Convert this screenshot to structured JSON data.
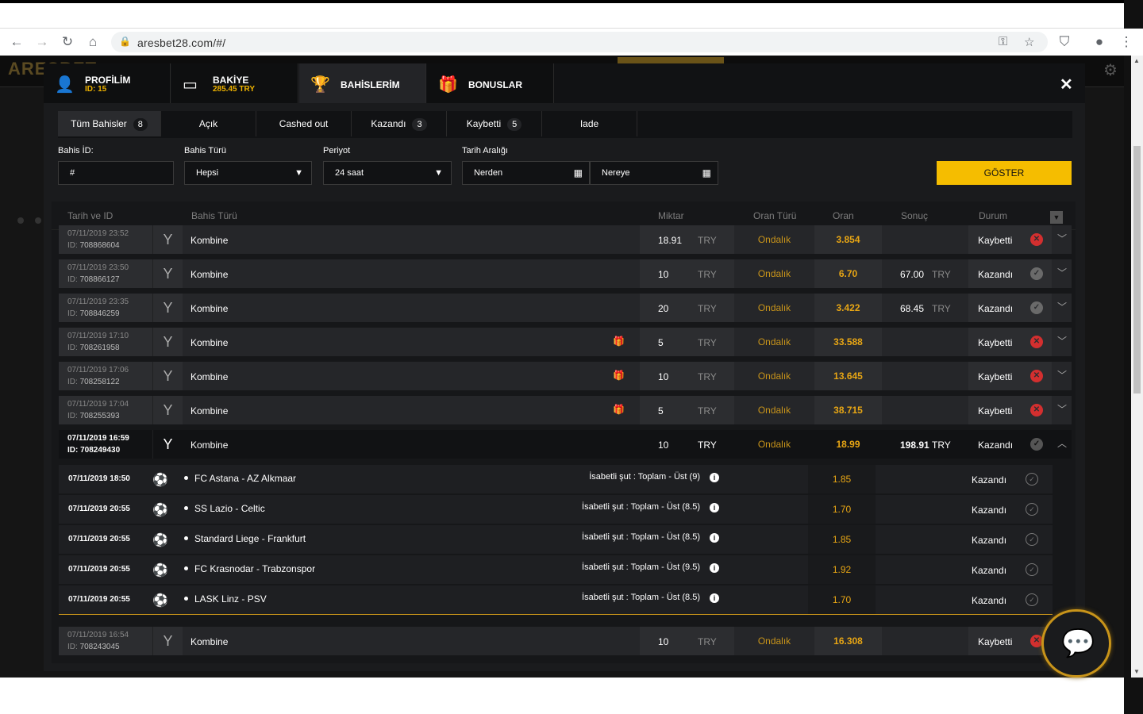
{
  "browser": {
    "url": "aresbet28.com/#/"
  },
  "site": {
    "logo": "ARESBET"
  },
  "modal": {
    "tabs": [
      {
        "label": "PROFİLİM",
        "sub": "ID: 15",
        "icon": "user-icon"
      },
      {
        "label": "BAKİYE",
        "sub": "285.45 TRY",
        "icon": "wallet-icon"
      },
      {
        "label": "BAHİSLERİM",
        "sub": "",
        "icon": "trophy-icon"
      },
      {
        "label": "BONUSLAR",
        "sub": "",
        "icon": "gift-icon"
      }
    ],
    "filter_tabs": [
      {
        "label": "Tüm Bahisler",
        "count": "8"
      },
      {
        "label": "Açık",
        "count": ""
      },
      {
        "label": "Cashed out",
        "count": ""
      },
      {
        "label": "Kazandı",
        "count": "3"
      },
      {
        "label": "Kaybetti",
        "count": "5"
      },
      {
        "label": "Iade",
        "count": ""
      }
    ],
    "filters": {
      "bet_id_label": "Bahis İD:",
      "bet_id_value": "#",
      "bet_type_label": "Bahis Türü",
      "bet_type_value": "Hepsi",
      "period_label": "Periyot",
      "period_value": "24 saat",
      "date_range_label": "Tarih Aralığı",
      "from_value": "Nerden",
      "to_value": "Nereye",
      "show_button": "GÖSTER"
    },
    "table": {
      "headers": {
        "date_id": "Tarih ve ID",
        "bet_type": "Bahis Türü",
        "amount": "Miktar",
        "odds_type": "Oran Türü",
        "odds": "Oran",
        "result": "Sonuç",
        "status": "Durum"
      },
      "rows": [
        {
          "date": "07/11/2019 23:52",
          "id": "708868604",
          "type": "Kombine",
          "gift": false,
          "amount": "18.91",
          "currency": "TRY",
          "odds_type": "Ondalık",
          "odds": "3.854",
          "result": "",
          "result_cur": "",
          "status": "Kaybetti",
          "won": false
        },
        {
          "date": "07/11/2019 23:50",
          "id": "708866127",
          "type": "Kombine",
          "gift": false,
          "amount": "10",
          "currency": "TRY",
          "odds_type": "Ondalık",
          "odds": "6.70",
          "result": "67.00",
          "result_cur": "TRY",
          "status": "Kazandı",
          "won": true
        },
        {
          "date": "07/11/2019 23:35",
          "id": "708846259",
          "type": "Kombine",
          "gift": false,
          "amount": "20",
          "currency": "TRY",
          "odds_type": "Ondalık",
          "odds": "3.422",
          "result": "68.45",
          "result_cur": "TRY",
          "status": "Kazandı",
          "won": true
        },
        {
          "date": "07/11/2019 17:10",
          "id": "708261958",
          "type": "Kombine",
          "gift": true,
          "amount": "5",
          "currency": "TRY",
          "odds_type": "Ondalık",
          "odds": "33.588",
          "result": "",
          "result_cur": "",
          "status": "Kaybetti",
          "won": false
        },
        {
          "date": "07/11/2019 17:06",
          "id": "708258122",
          "type": "Kombine",
          "gift": true,
          "amount": "10",
          "currency": "TRY",
          "odds_type": "Ondalık",
          "odds": "13.645",
          "result": "",
          "result_cur": "",
          "status": "Kaybetti",
          "won": false
        },
        {
          "date": "07/11/2019 17:04",
          "id": "708255393",
          "type": "Kombine",
          "gift": true,
          "amount": "5",
          "currency": "TRY",
          "odds_type": "Ondalık",
          "odds": "38.715",
          "result": "",
          "result_cur": "",
          "status": "Kaybetti",
          "won": false
        },
        {
          "date": "07/11/2019 16:59",
          "id": "708249430",
          "type": "Kombine",
          "gift": false,
          "amount": "10",
          "currency": "TRY",
          "odds_type": "Ondalık",
          "odds": "18.99",
          "result": "198.91",
          "result_cur": "TRY",
          "status": "Kazandı",
          "won": true,
          "open": true
        },
        {
          "date": "07/11/2019 16:54",
          "id": "708243045",
          "type": "Kombine",
          "gift": false,
          "amount": "10",
          "currency": "TRY",
          "odds_type": "Ondalık",
          "odds": "16.308",
          "result": "",
          "result_cur": "",
          "status": "Kaybetti",
          "won": false
        }
      ],
      "details": [
        {
          "date": "07/11/2019 18:50",
          "match": "FC Astana - AZ Alkmaar",
          "market": "İsabetli şut : Toplam - Üst (9)",
          "odds": "1.85",
          "status": "Kazandı"
        },
        {
          "date": "07/11/2019 20:55",
          "match": "SS Lazio - Celtic",
          "market": "İsabetli şut : Toplam - Üst (8.5)",
          "odds": "1.70",
          "status": "Kazandı"
        },
        {
          "date": "07/11/2019 20:55",
          "match": "Standard Liege - Frankfurt",
          "market": "İsabetli şut : Toplam - Üst (8.5)",
          "odds": "1.85",
          "status": "Kazandı"
        },
        {
          "date": "07/11/2019 20:55",
          "match": "FC Krasnodar - Trabzonspor",
          "market": "İsabetli şut : Toplam - Üst (9.5)",
          "odds": "1.92",
          "status": "Kazandı"
        },
        {
          "date": "07/11/2019 20:55",
          "match": "LASK Linz - PSV",
          "market": "İsabetli şut : Toplam - Üst (8.5)",
          "odds": "1.70",
          "status": "Kazandı"
        }
      ]
    }
  },
  "colors": {
    "accent": "#f5bd00",
    "odds": "#e8a614",
    "lost": "#d32f2f"
  }
}
